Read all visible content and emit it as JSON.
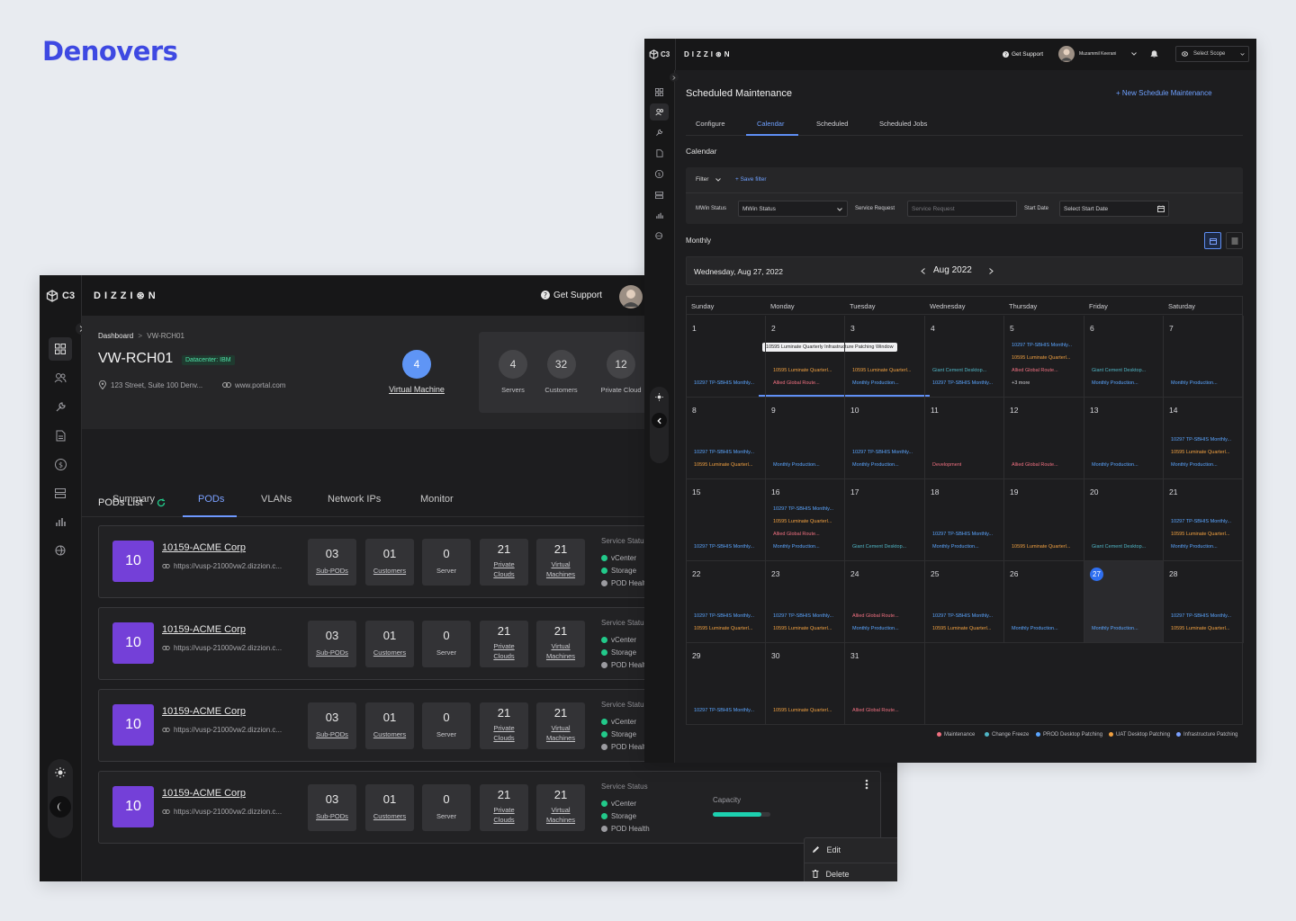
{
  "brand": "Denovers",
  "w1": {
    "c3": "C3",
    "logo": "DIZZI⊛N",
    "support": "Get Support",
    "breadcrumb": {
      "root": "Dashboard",
      "sep": ">",
      "current": "VW-RCH01"
    },
    "title": "VW-RCH01",
    "badge": "Datacenter: IBM",
    "address": "123 Street, Suite 100 Denv...",
    "website": "www.portal.com",
    "vm": {
      "value": "4",
      "label": "Virtual Machine"
    },
    "stats": [
      {
        "value": "4",
        "label": "Servers"
      },
      {
        "value": "32",
        "label": "Customers"
      },
      {
        "value": "12",
        "label": "Private Cloud"
      }
    ],
    "tabs": [
      "Summary",
      "PODs",
      "VLANs",
      "Network IPs",
      "Monitor"
    ],
    "pods_title": "PODs List",
    "pods": [
      {
        "num": "10",
        "name": "10159-ACME Corp",
        "url": "https://vusp-21000vw2.dizzion.c...",
        "subpods": "03",
        "customers": "01",
        "server": "0",
        "clouds": "21",
        "vms": "21"
      },
      {
        "num": "10",
        "name": "10159-ACME Corp",
        "url": "https://vusp-21000vw2.dizzion.c...",
        "subpods": "03",
        "customers": "01",
        "server": "0",
        "clouds": "21",
        "vms": "21"
      },
      {
        "num": "10",
        "name": "10159-ACME Corp",
        "url": "https://vusp-21000vw2.dizzion.c...",
        "subpods": "03",
        "customers": "01",
        "server": "0",
        "clouds": "21",
        "vms": "21"
      },
      {
        "num": "10",
        "name": "10159-ACME Corp",
        "url": "https://vusp-21000vw2.dizzion.c...",
        "subpods": "03",
        "customers": "01",
        "server": "0",
        "clouds": "21",
        "vms": "21"
      }
    ],
    "pod_labels": {
      "subpods": "Sub-PODs",
      "customers": "Customers",
      "server": "Server",
      "clouds1": "Private",
      "clouds2": "Clouds",
      "vms1": "Virtual",
      "vms2": "Machines"
    },
    "service": {
      "title": "Service Status",
      "vcenter": "vCenter",
      "storage": "Storage",
      "health": "POD Health"
    },
    "capacity": "Capacity",
    "capacity_fill": 0.85,
    "menu": {
      "edit": "Edit",
      "delete": "Delete"
    },
    "colors": {
      "accent": "#7aa0ff",
      "pod": "#7440d8",
      "green": "#22c98a",
      "grey": "#9b9ba0"
    }
  },
  "w2": {
    "c3": "C3",
    "logo": "DIZZI⊛N",
    "support": "Get Support",
    "user": "Muzammil Keerani",
    "scope": "Select Scope",
    "title": "Scheduled Maintenance",
    "new_button": "+ New Schedule Maintenance",
    "tabs": [
      "Configure",
      "Calendar",
      "Scheduled",
      "Scheduled Jobs"
    ],
    "section": "Calendar",
    "filter": "Filter",
    "save_filter": "+ Save filter",
    "mwin_label": "MWin Status",
    "mwin_value": "MWin Status",
    "sr_label": "Service Request",
    "sr_placeholder": "Service Request",
    "start_label": "Start Date",
    "start_value": "Select Start Date",
    "monthly": "Monthly",
    "current_date": "Wednesday, Aug 27, 2022",
    "month": "Aug 2022",
    "days": [
      "Sunday",
      "Monday",
      "Tuesday",
      "Wednesday",
      "Thursday",
      "Friday",
      "Saturday"
    ],
    "tooltip": "10595 Luminate Quarterly Infrastructure Patching Window",
    "legend": [
      "Maintenance",
      "Change Freeze",
      "PROD Desktop Patching",
      "UAT Desktop Patching",
      "Infrastructure Patching"
    ],
    "legend_colors": [
      "#f07080",
      "#4fb5c5",
      "#5aa5ff",
      "#f0a040",
      "#7aa0ff"
    ],
    "weeks": [
      [
        {
          "d": "1",
          "ev": [
            [
              "b",
              "10297 TP-SBHIS Monthly..."
            ]
          ]
        },
        {
          "d": "2",
          "ev": [
            [
              "o",
              "10595 Luminate Quarterl..."
            ],
            [
              "p",
              "Allied Global Route..."
            ]
          ]
        },
        {
          "d": "3",
          "ev": [
            [
              "o",
              "10595 Luminate Quarterl..."
            ],
            [
              "b",
              "Monthly Production..."
            ]
          ]
        },
        {
          "d": "4",
          "ev": [
            [
              "t",
              "Giant Cement Desktop..."
            ],
            [
              "b",
              "10297 TP-SBHIS Monthly..."
            ]
          ]
        },
        {
          "d": "5",
          "ev": [
            [
              "b",
              "10297 TP-SBHIS Monthly..."
            ],
            [
              "o",
              "10595 Luminate Quarterl..."
            ],
            [
              "p",
              "Allied Global Route..."
            ],
            [
              "w",
              "+3 more"
            ]
          ]
        },
        {
          "d": "6",
          "ev": [
            [
              "t",
              "Giant Cement Desktop..."
            ],
            [
              "b",
              "Monthly Production..."
            ]
          ]
        },
        {
          "d": "7",
          "ev": [
            [
              "b",
              "Monthly Production..."
            ]
          ]
        }
      ],
      [
        {
          "d": "8",
          "ev": [
            [
              "b",
              "10297 TP-SBHIS Monthly..."
            ],
            [
              "o",
              "10595 Luminate Quarterl..."
            ]
          ]
        },
        {
          "d": "9",
          "ev": [
            [
              "b",
              "Monthly Production..."
            ]
          ]
        },
        {
          "d": "10",
          "ev": [
            [
              "b",
              "10297 TP-SBHIS Monthly..."
            ],
            [
              "b",
              "Monthly Production..."
            ]
          ]
        },
        {
          "d": "11",
          "ev": [
            [
              "p",
              "Development"
            ]
          ]
        },
        {
          "d": "12",
          "ev": [
            [
              "p",
              "Allied Global Route..."
            ]
          ]
        },
        {
          "d": "13",
          "ev": [
            [
              "b",
              "Monthly Production..."
            ]
          ]
        },
        {
          "d": "14",
          "ev": [
            [
              "b",
              "10297 TP-SBHIS Monthly..."
            ],
            [
              "o",
              "10595 Luminate Quarterl..."
            ],
            [
              "b",
              "Monthly Production..."
            ]
          ]
        }
      ],
      [
        {
          "d": "15",
          "ev": [
            [
              "b",
              "10297 TP-SBHIS Monthly..."
            ]
          ]
        },
        {
          "d": "16",
          "ev": [
            [
              "b",
              "10297 TP-SBHIS Monthly..."
            ],
            [
              "o",
              "10595 Luminate Quarterl..."
            ],
            [
              "p",
              "Allied Global Route..."
            ],
            [
              "b",
              "Monthly Production..."
            ]
          ]
        },
        {
          "d": "17",
          "ev": [
            [
              "t",
              "Giant Cement Desktop..."
            ]
          ]
        },
        {
          "d": "18",
          "ev": [
            [
              "b",
              "10297 TP-SBHIS Monthly..."
            ],
            [
              "b",
              "Monthly Production..."
            ]
          ]
        },
        {
          "d": "19",
          "ev": [
            [
              "o",
              "10595 Luminate Quarterl..."
            ]
          ]
        },
        {
          "d": "20",
          "ev": [
            [
              "t",
              "Giant Cement Desktop..."
            ]
          ]
        },
        {
          "d": "21",
          "ev": [
            [
              "b",
              "10297 TP-SBHIS Monthly..."
            ],
            [
              "o",
              "10595 Luminate Quarterl..."
            ],
            [
              "b",
              "Monthly Production..."
            ]
          ]
        }
      ],
      [
        {
          "d": "22",
          "ev": [
            [
              "b",
              "10297 TP-SBHIS Monthly..."
            ],
            [
              "o",
              "10595 Luminate Quarterl..."
            ]
          ]
        },
        {
          "d": "23",
          "ev": [
            [
              "b",
              "10297 TP-SBHIS Monthly..."
            ],
            [
              "o",
              "10595 Luminate Quarterl..."
            ]
          ]
        },
        {
          "d": "24",
          "ev": [
            [
              "p",
              "Allied Global Route..."
            ],
            [
              "b",
              "Monthly Production..."
            ]
          ]
        },
        {
          "d": "25",
          "ev": [
            [
              "b",
              "10297 TP-SBHIS Monthly..."
            ],
            [
              "o",
              "10595 Luminate Quarterl..."
            ]
          ]
        },
        {
          "d": "26",
          "ev": [
            [
              "b",
              "Monthly Production..."
            ]
          ]
        },
        {
          "d": "27",
          "ev": [
            [
              "b",
              "Monthly Production..."
            ]
          ],
          "today": true
        },
        {
          "d": "28",
          "ev": [
            [
              "b",
              "10297 TP-SBHIS Monthly..."
            ],
            [
              "o",
              "10595 Luminate Quarterl..."
            ]
          ]
        }
      ],
      [
        {
          "d": "29",
          "ev": [
            [
              "b",
              "10297 TP-SBHIS Monthly..."
            ]
          ]
        },
        {
          "d": "30",
          "ev": [
            [
              "o",
              "10595 Luminate Quarterl..."
            ]
          ]
        },
        {
          "d": "31",
          "ev": [
            [
              "p",
              "Allied Global Route..."
            ]
          ]
        }
      ]
    ]
  }
}
